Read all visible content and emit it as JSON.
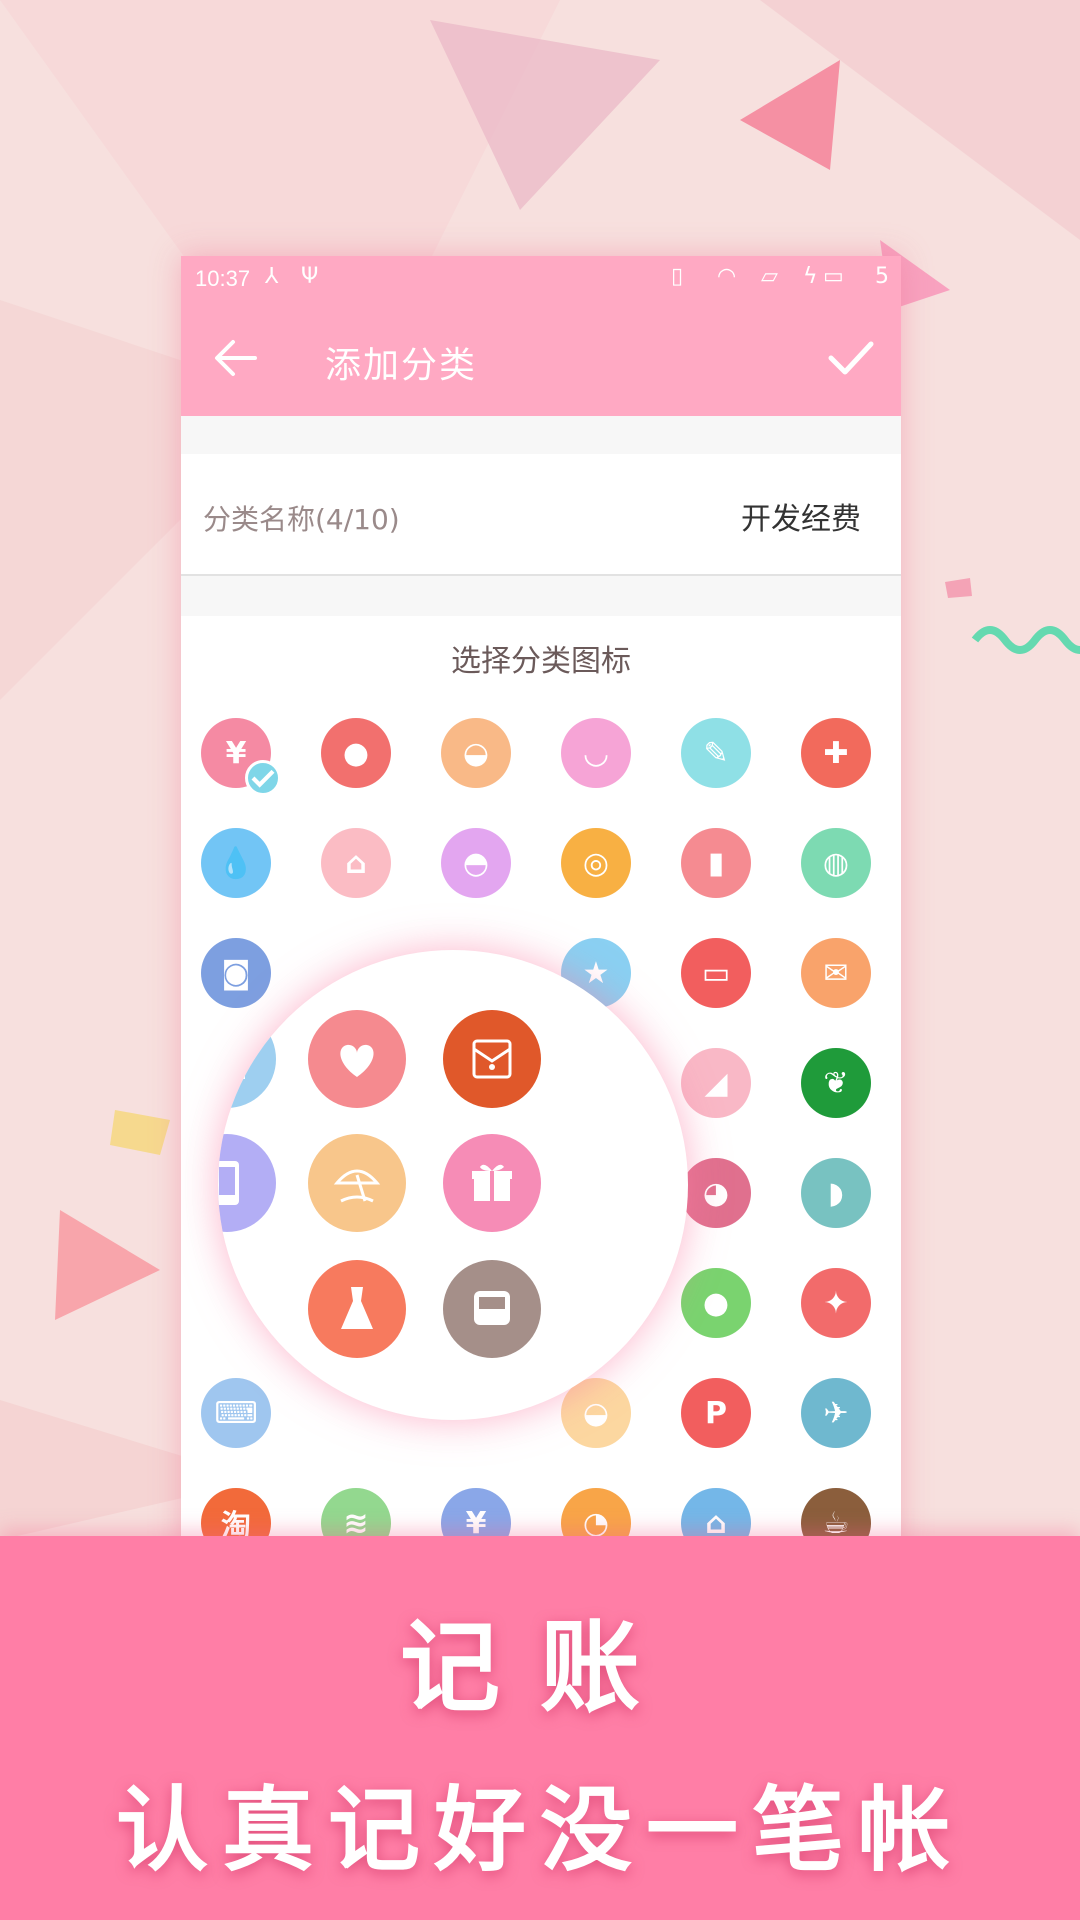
{
  "colors": {
    "accent": "#ffa9c3",
    "banner": "#ff7ea6",
    "background": "#f7e0de"
  },
  "statusbar": {
    "time": "10:37",
    "battery_level": "5"
  },
  "appbar": {
    "title": "添加分类",
    "back_icon": "arrow-left-icon",
    "confirm_icon": "check-icon"
  },
  "form": {
    "name_label": "分类名称(4/10)",
    "name_value": "开发经费"
  },
  "icon_section": {
    "title": "选择分类图标"
  },
  "icons": [
    {
      "name": "yen-icon",
      "color": "#f58aa3",
      "glyph": "¥",
      "selected": true
    },
    {
      "name": "cookie-icon",
      "color": "#f2706e",
      "glyph": "●"
    },
    {
      "name": "hat-icon",
      "color": "#f9b987",
      "glyph": "◒"
    },
    {
      "name": "underwear-icon",
      "color": "#f6a4d6",
      "glyph": "◡"
    },
    {
      "name": "pencil-icon",
      "color": "#8fe0e6",
      "glyph": "✎"
    },
    {
      "name": "first-aid-icon",
      "color": "#f26a5c",
      "glyph": "✚"
    },
    {
      "name": "water-drop-icon",
      "color": "#72c5f5",
      "glyph": "💧"
    },
    {
      "name": "house-icon",
      "color": "#fbbcc4",
      "glyph": "⌂"
    },
    {
      "name": "cupcake-icon",
      "color": "#e3a6f0",
      "glyph": "◓"
    },
    {
      "name": "basketball-icon",
      "color": "#f8b043",
      "glyph": "◎"
    },
    {
      "name": "lipstick-icon",
      "color": "#f58b91",
      "glyph": "▮"
    },
    {
      "name": "toilet-paper-icon",
      "color": "#7ddab2",
      "glyph": "◍"
    },
    {
      "name": "camera-icon",
      "color": "#7d9fe0",
      "glyph": "◙"
    },
    {
      "name": "star-icon",
      "color": "#8ad0f2",
      "glyph": "★"
    },
    {
      "name": "credit-card-icon",
      "color": "#f25e5e",
      "glyph": "▭"
    },
    {
      "name": "red-envelope-icon",
      "color": "#f9a36b",
      "glyph": "✉"
    },
    {
      "name": "high-heel-icon",
      "color": "#f9b8c6",
      "glyph": "◢"
    },
    {
      "name": "leaf-icon",
      "color": "#1f9b3a",
      "glyph": "❦"
    },
    {
      "name": "mask-icon",
      "color": "#e0708e",
      "glyph": "◕"
    },
    {
      "name": "fish-icon",
      "color": "#78c2c1",
      "glyph": "◗"
    },
    {
      "name": "apple-icon",
      "color": "#7ad36f",
      "glyph": "●"
    },
    {
      "name": "party-popper-icon",
      "color": "#f26b6b",
      "glyph": "✦"
    },
    {
      "name": "keyboard-icon",
      "color": "#9fc6ef",
      "glyph": "⌨"
    },
    {
      "name": "hat-2-icon",
      "color": "#fcd7a0",
      "glyph": "◒"
    },
    {
      "name": "parking-icon",
      "color": "#f25e5e",
      "glyph": "P"
    },
    {
      "name": "airplane-icon",
      "color": "#6fb8cf",
      "glyph": "✈"
    },
    {
      "name": "taobao-icon",
      "color": "#f26a3a",
      "glyph": "淘"
    },
    {
      "name": "wifi-icon",
      "color": "#93d88f",
      "glyph": "≋"
    },
    {
      "name": "money-bag-icon",
      "color": "#8aa7e8",
      "glyph": "¥"
    },
    {
      "name": "lollipop-icon",
      "color": "#f8a548",
      "glyph": "◔"
    },
    {
      "name": "bank-icon",
      "color": "#74b7e8",
      "glyph": "⌂"
    },
    {
      "name": "coffee-icon",
      "color": "#8b5e3c",
      "glyph": "☕"
    }
  ],
  "magnifier_icons": [
    {
      "name": "chart-bars-icon",
      "color": "#9ecff0"
    },
    {
      "name": "heart-icon",
      "color": "#f58a8f"
    },
    {
      "name": "envelope-icon",
      "color": "#e0582a"
    },
    {
      "name": "phone-icon",
      "color": "#b3aef5"
    },
    {
      "name": "beach-umbrella-icon",
      "color": "#f8c68b"
    },
    {
      "name": "gift-icon",
      "color": "#f68cb6"
    },
    {
      "name": "dress-icon",
      "color": "#f77a5e"
    },
    {
      "name": "bus-icon",
      "color": "#a58f89"
    }
  ],
  "banner": {
    "title": "记账",
    "subtitle": "认真记好没一笔帐"
  }
}
